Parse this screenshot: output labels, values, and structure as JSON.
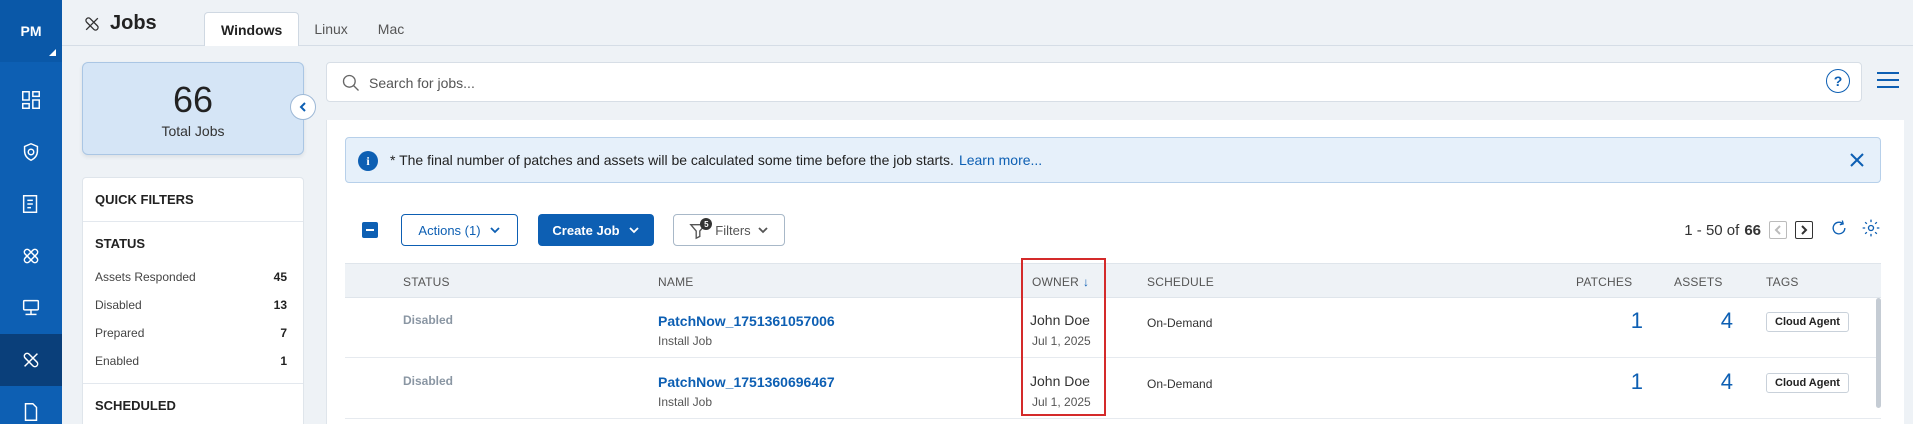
{
  "rail": {
    "logo": "PM",
    "icons": [
      "dashboard-icon",
      "shield-icon",
      "inventory-icon",
      "patch-icon",
      "deploy-icon",
      "jobs-icon",
      "document-icon"
    ]
  },
  "header": {
    "title": "Jobs",
    "tabs": [
      {
        "label": "Windows",
        "active": true
      },
      {
        "label": "Linux",
        "active": false
      },
      {
        "label": "Mac",
        "active": false
      }
    ]
  },
  "summary": {
    "total": "66",
    "total_label": "Total Jobs"
  },
  "quick_filters": {
    "title": "QUICK FILTERS",
    "status_title": "STATUS",
    "status": [
      {
        "label": "Assets Responded",
        "count": "45"
      },
      {
        "label": "Disabled",
        "count": "13"
      },
      {
        "label": "Prepared",
        "count": "7"
      },
      {
        "label": "Enabled",
        "count": "1"
      }
    ],
    "scheduled_title": "SCHEDULED"
  },
  "search": {
    "placeholder": "Search for jobs...",
    "help": "?"
  },
  "banner": {
    "message": "* The final number of patches and assets will be calculated some time before the job starts.",
    "link": "Learn more..."
  },
  "toolbar": {
    "actions_label": "Actions (1)",
    "create_label": "Create Job",
    "filters_label": "Filters",
    "filters_count": "5"
  },
  "pager": {
    "range": "1 - 50 of",
    "total": "66"
  },
  "table": {
    "columns": {
      "status": "STATUS",
      "name": "NAME",
      "owner": "OWNER",
      "schedule": "SCHEDULE",
      "patches": "PATCHES",
      "assets": "ASSETS",
      "tags": "TAGS"
    },
    "sort_indicator": "↓",
    "rows": [
      {
        "status": "Disabled",
        "name": "PatchNow_1751361057006",
        "type": "Install Job",
        "owner": "John Doe",
        "date": "Jul 1, 2025",
        "schedule": "On-Demand",
        "patches": "1",
        "assets": "4",
        "tag": "Cloud Agent"
      },
      {
        "status": "Disabled",
        "name": "PatchNow_1751360696467",
        "type": "Install Job",
        "owner": "John Doe",
        "date": "Jul 1, 2025",
        "schedule": "On-Demand",
        "patches": "1",
        "assets": "4",
        "tag": "Cloud Agent"
      }
    ]
  },
  "colors": {
    "brand": "#0d5fb3",
    "highlight": "#d42a2a"
  }
}
